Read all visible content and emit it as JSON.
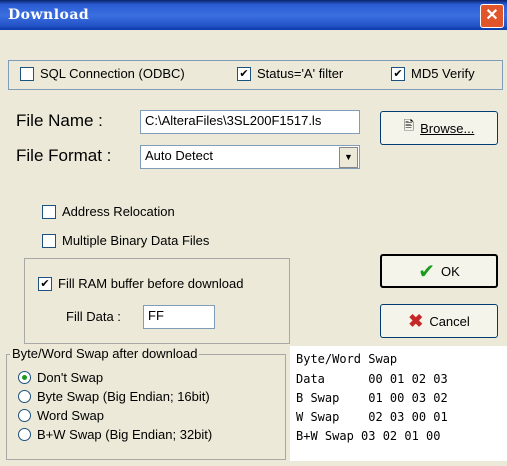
{
  "window": {
    "title": "Download",
    "close_glyph": "✕"
  },
  "options": [
    {
      "label": "SQL Connection (ODBC)",
      "checked": false
    },
    {
      "label": "Status='A' filter",
      "checked": true
    },
    {
      "label": "MD5 Verify",
      "checked": true
    }
  ],
  "file_name": {
    "label": "File Name :",
    "value": "C:\\AlteraFiles\\3SL200F1517.ls"
  },
  "file_format": {
    "label": "File Format :",
    "value": "Auto Detect"
  },
  "browse": {
    "label": "Browse..."
  },
  "address_relocation": {
    "label": "Address Relocation",
    "checked": false
  },
  "multiple_binary": {
    "label": "Multiple Binary Data Files",
    "checked": false
  },
  "fill_ram": {
    "label": "Fill RAM buffer before download",
    "checked": true
  },
  "fill_data": {
    "label": "Fill Data :",
    "value": "FF"
  },
  "ok": {
    "label": "OK"
  },
  "cancel": {
    "label": "Cancel"
  },
  "swap_group": {
    "title": "Byte/Word Swap after download",
    "options": [
      {
        "label": "Don't Swap",
        "selected": true
      },
      {
        "label": "Byte Swap (Big Endian; 16bit)",
        "selected": false
      },
      {
        "label": "Word Swap",
        "selected": false
      },
      {
        "label": "B+W Swap (Big Endian; 32bit)",
        "selected": false
      }
    ]
  },
  "swap_table": {
    "title": "Byte/Word Swap",
    "rows": [
      "Data      00 01 02 03",
      "B Swap    01 00 03 02",
      "W Swap    02 03 00 01",
      "B+W Swap 03 02 01 00"
    ]
  },
  "icons": {
    "ok": "checkmark-icon",
    "cancel": "x-icon",
    "browse": "document-icon"
  }
}
